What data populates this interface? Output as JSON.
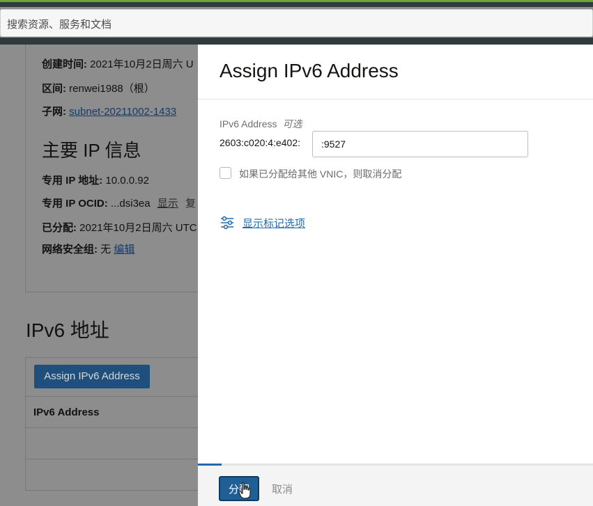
{
  "search": {
    "placeholder": "搜索资源、服务和文档"
  },
  "background": {
    "details": [
      {
        "label": "创建时间:",
        "value": "2021年10月2日周六 U"
      },
      {
        "label": "区间:",
        "value": "renwei1988（根）"
      },
      {
        "label": "子网:",
        "link": "subnet-20211002-1433"
      }
    ],
    "primary_ip_heading": "主要 IP 信息",
    "ip_details": [
      {
        "label": "专用 IP 地址:",
        "value": "10.0.0.92"
      },
      {
        "label": "专用 IP OCID:",
        "value": "...dsi3ea",
        "action1": "显示",
        "action2": "复"
      },
      {
        "label": "已分配:",
        "value": "2021年10月2日周六 UTC"
      },
      {
        "label": "网络安全组:",
        "value": "无",
        "link": "编辑"
      }
    ],
    "ipv6_heading": "IPv6 地址",
    "assign_button": "Assign IPv6 Address",
    "table_header": "IPv6 Address"
  },
  "panel": {
    "title": "Assign IPv6 Address",
    "field_label": "IPv6 Address",
    "optional_label": "可选",
    "prefix": "2603:c020:4:e402:",
    "input_value": ":9527",
    "checkbox_label": "如果已分配给其他 VNIC，则取消分配",
    "tags_link": "显示标记选项",
    "progress": 0.06
  },
  "footer": {
    "assign_button": "分配",
    "cancel_button": "取消"
  },
  "colors": {
    "accent": "#1f5f95",
    "link": "#1e6bb0",
    "overlay": "#8d8d8d"
  },
  "icons": [
    "sliders-icon",
    "hand-cursor-icon"
  ]
}
